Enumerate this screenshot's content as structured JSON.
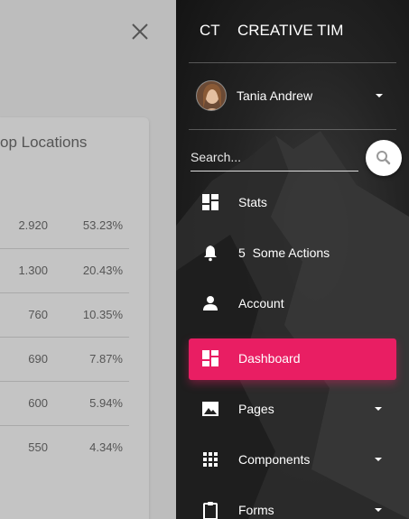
{
  "background": {
    "card_title": "op Locations",
    "rows": [
      {
        "value": "2.920",
        "percent": "53.23%"
      },
      {
        "value": "1.300",
        "percent": "20.43%"
      },
      {
        "value": "760",
        "percent": "10.35%"
      },
      {
        "value": "690",
        "percent": "7.87%"
      },
      {
        "value": "600",
        "percent": "5.94%"
      },
      {
        "value": "550",
        "percent": "4.34%"
      }
    ]
  },
  "sidebar": {
    "brand_mini": "CT",
    "brand_name": "CREATIVE TIM",
    "user_name": "Tania Andrew",
    "search_placeholder": "Search...",
    "items": [
      {
        "label": "Stats",
        "icon": "dashboard-icon"
      },
      {
        "label": "5  Some Actions",
        "icon": "bell-icon"
      },
      {
        "label": "Account",
        "icon": "person-icon"
      },
      {
        "label": "Dashboard",
        "icon": "dashboard-icon",
        "active": true
      },
      {
        "label": "Pages",
        "icon": "image-icon"
      },
      {
        "label": "Components",
        "icon": "grid-icon"
      },
      {
        "label": "Forms",
        "icon": "clipboard-icon"
      }
    ]
  },
  "colors": {
    "active": "#e91e63"
  }
}
